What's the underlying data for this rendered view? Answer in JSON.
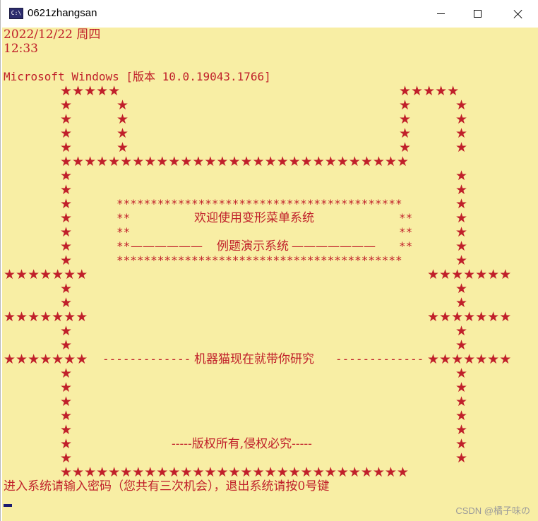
{
  "window": {
    "title": "0621zhangsan",
    "icon_name": "console-app-icon",
    "icon_text": "C:\\"
  },
  "colors": {
    "background": "#f8eea4",
    "text": "#c0202a"
  },
  "console": {
    "date_line": "2022/12/22 周四",
    "time_line": "12:33",
    "version_line": "Microsoft Windows [版本 10.0.19043.1766]",
    "welcome_title": "欢迎使用变形菜单系统",
    "demo_title": "例题演示系统",
    "robot_text": "机器猫现在就带你研究",
    "copyright_text": "-----版权所有,侵权必究-----",
    "prompt_line": "进入系统请输入密码（您共有三次机会），退出系统请按0号键"
  },
  "watermark": "CSDN @橘子味の"
}
